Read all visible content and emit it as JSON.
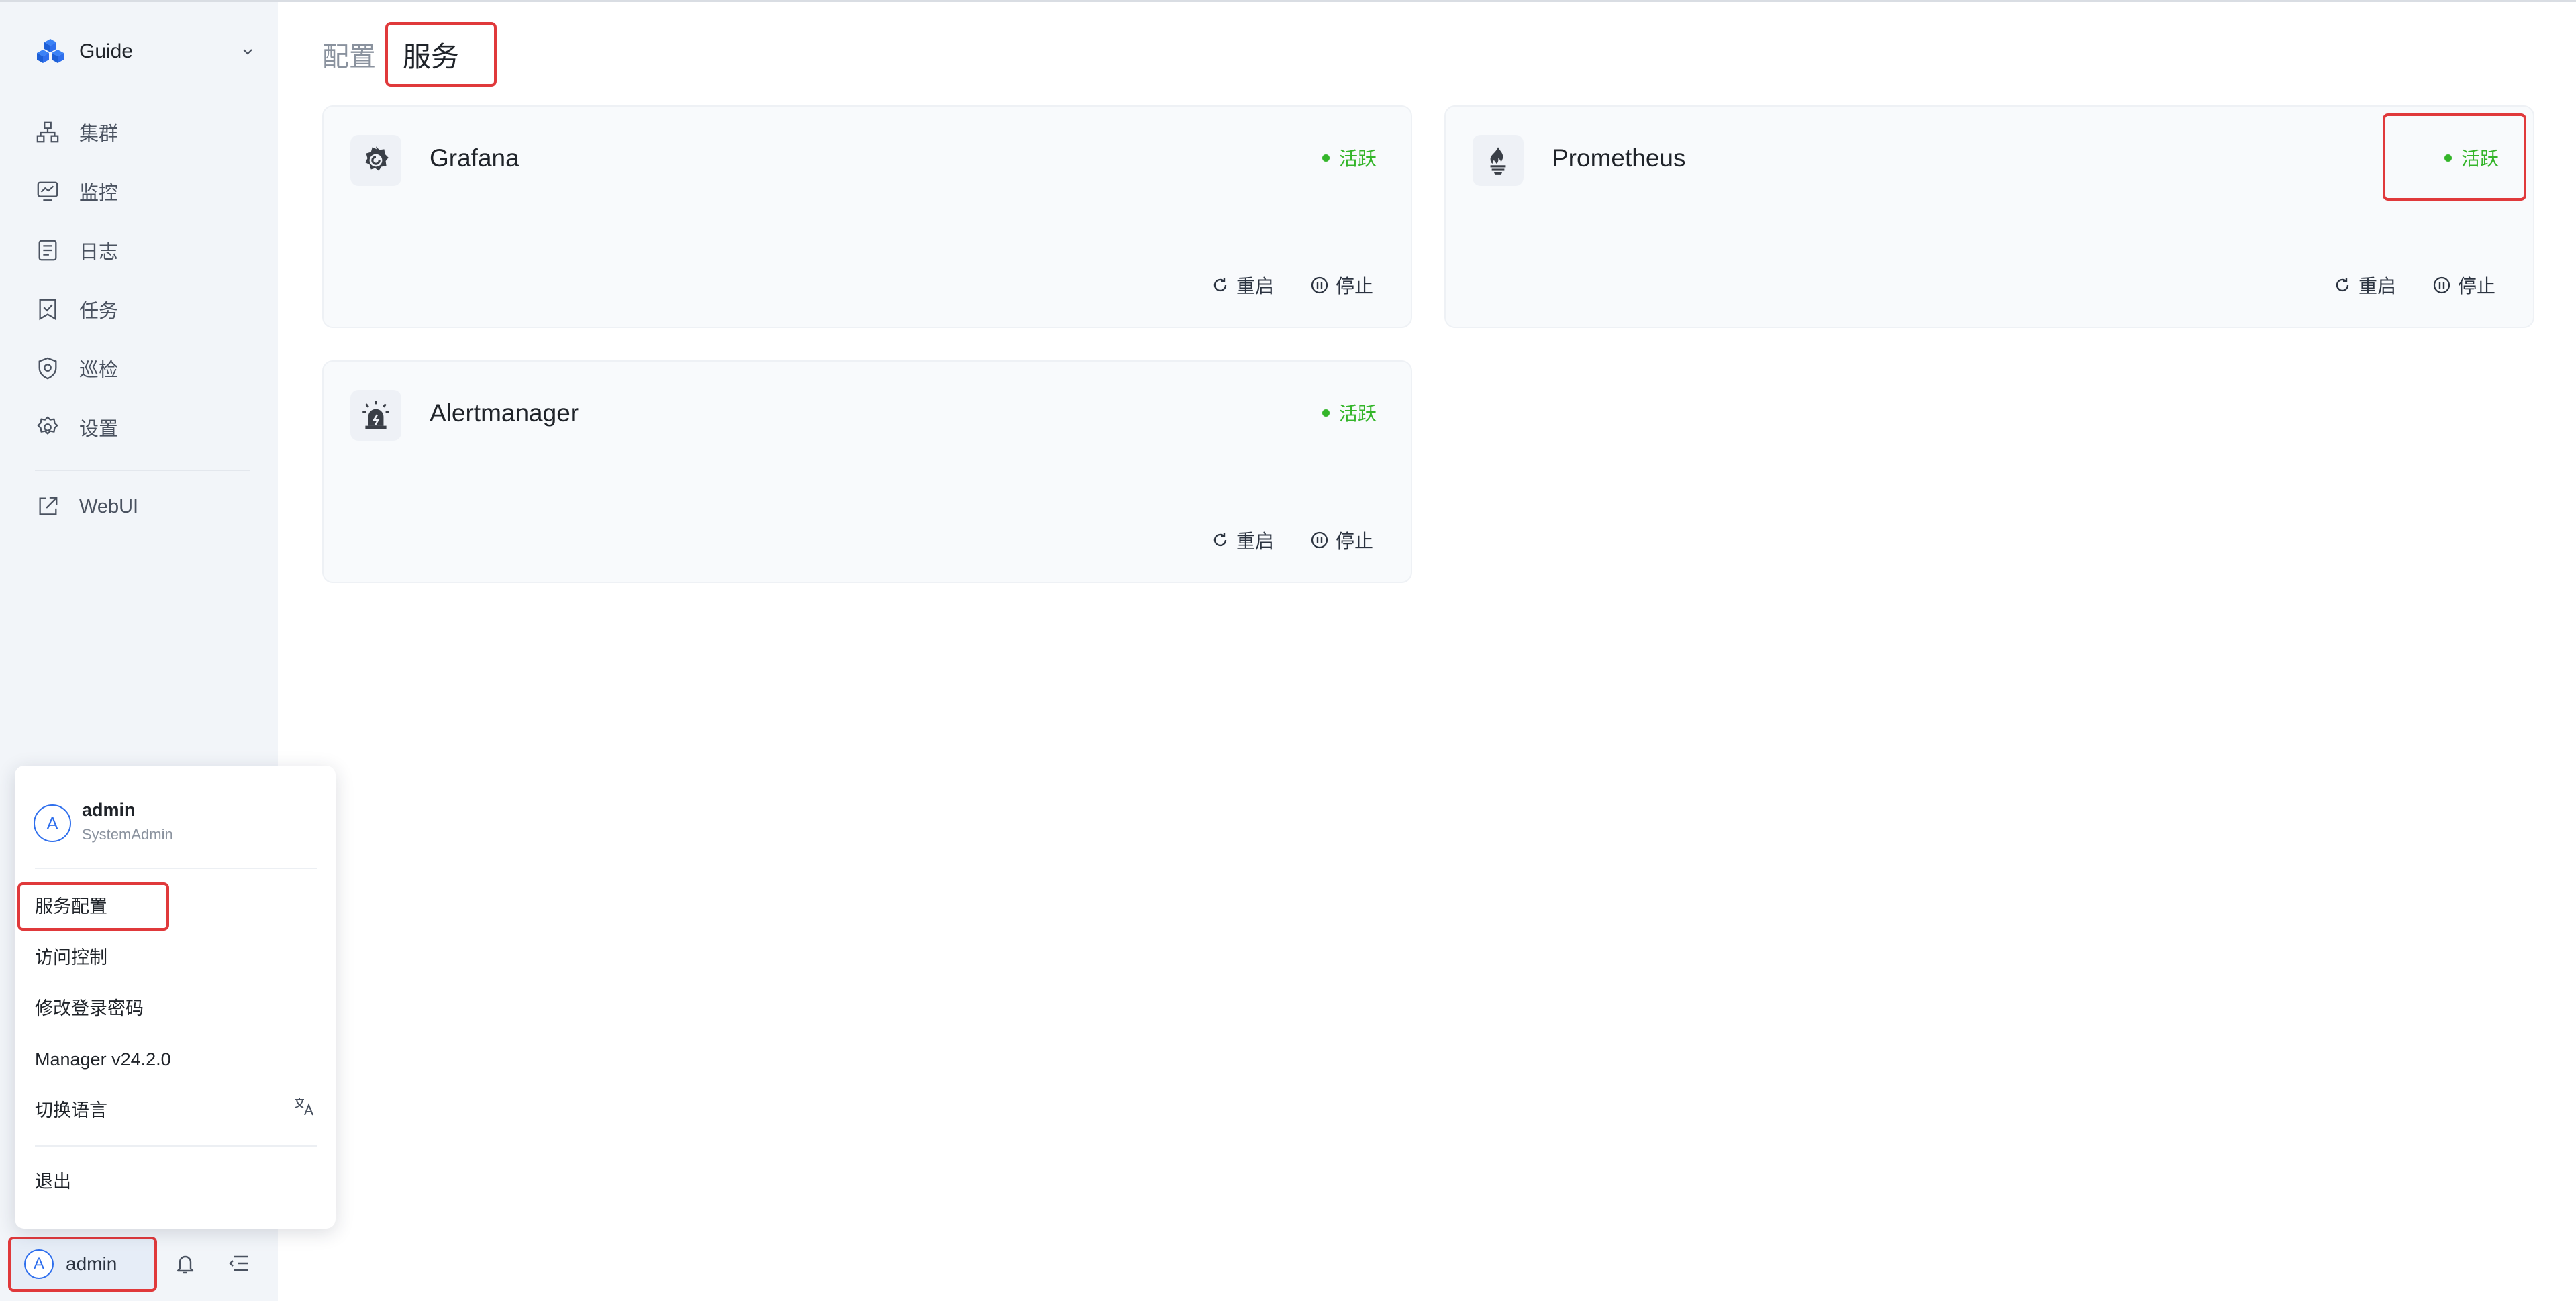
{
  "sidebar": {
    "brand": "Guide",
    "items": [
      {
        "label": "集群",
        "icon": "cluster-icon"
      },
      {
        "label": "监控",
        "icon": "monitor-icon"
      },
      {
        "label": "日志",
        "icon": "log-icon"
      },
      {
        "label": "任务",
        "icon": "task-icon"
      },
      {
        "label": "巡检",
        "icon": "inspection-icon"
      },
      {
        "label": "设置",
        "icon": "gear-icon"
      }
    ],
    "webui": {
      "label": "WebUI",
      "icon": "external-link-icon"
    }
  },
  "user_menu": {
    "avatar_letter": "A",
    "username": "admin",
    "role": "SystemAdmin",
    "items": [
      "服务配置",
      "访问控制",
      "修改登录密码",
      "Manager v24.2.0",
      "切换语言"
    ],
    "logout": "退出"
  },
  "bottom": {
    "avatar_letter": "A",
    "username": "admin"
  },
  "breadcrumb": {
    "parent": "配置",
    "current": "服务"
  },
  "services": [
    {
      "name": "Grafana",
      "status": "活跃",
      "restart": "重启",
      "stop": "停止"
    },
    {
      "name": "Prometheus",
      "status": "活跃",
      "restart": "重启",
      "stop": "停止"
    },
    {
      "name": "Alertmanager",
      "status": "活跃",
      "restart": "重启",
      "stop": "停止"
    }
  ],
  "colors": {
    "accent": "#2f6fed",
    "active": "#34b52a",
    "highlight": "#e0393b"
  }
}
